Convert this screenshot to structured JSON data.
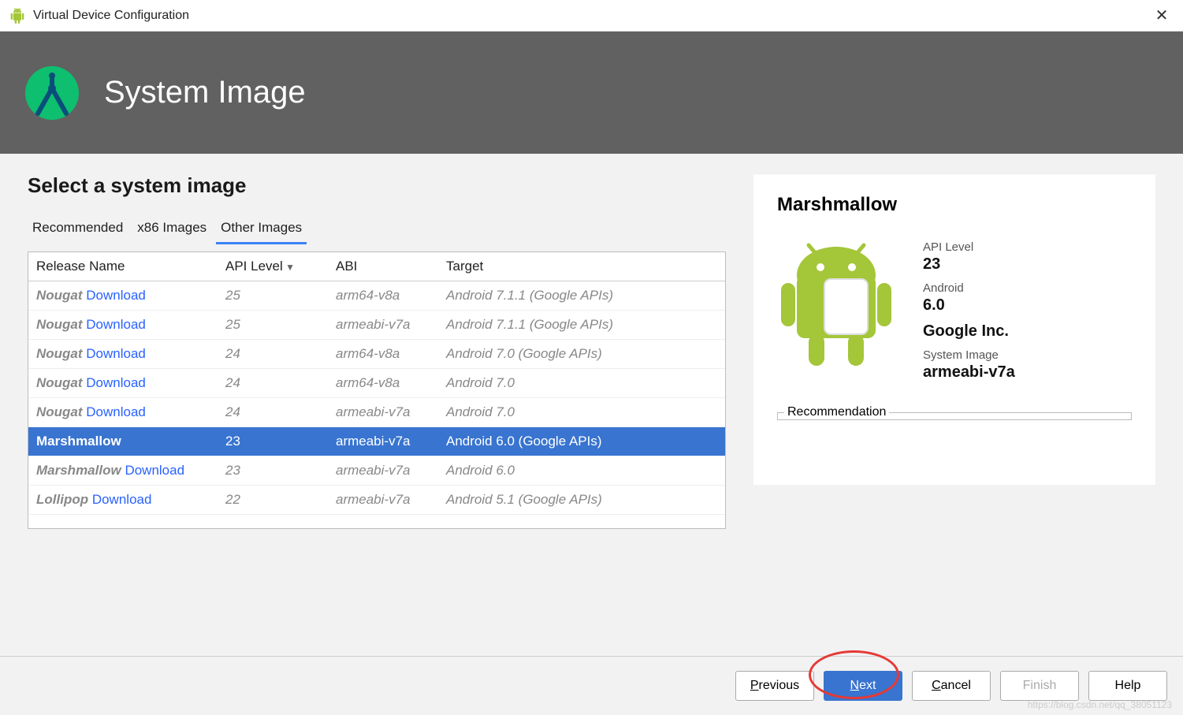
{
  "window": {
    "title": "Virtual Device Configuration"
  },
  "banner": {
    "title": "System Image"
  },
  "page": {
    "heading": "Select a system image"
  },
  "tabs": [
    {
      "label": "Recommended",
      "active": false
    },
    {
      "label": "x86 Images",
      "active": false
    },
    {
      "label": "Other Images",
      "active": true
    }
  ],
  "table": {
    "columns": [
      "Release Name",
      "API Level",
      "ABI",
      "Target"
    ],
    "sortedColumnIndex": 1,
    "rows": [
      {
        "release": "Nougat",
        "download": "Download",
        "api": "25",
        "abi": "arm64-v8a",
        "target": "Android 7.1.1 (Google APIs)",
        "selected": false,
        "hasDownload": true
      },
      {
        "release": "Nougat",
        "download": "Download",
        "api": "25",
        "abi": "armeabi-v7a",
        "target": "Android 7.1.1 (Google APIs)",
        "selected": false,
        "hasDownload": true
      },
      {
        "release": "Nougat",
        "download": "Download",
        "api": "24",
        "abi": "arm64-v8a",
        "target": "Android 7.0 (Google APIs)",
        "selected": false,
        "hasDownload": true
      },
      {
        "release": "Nougat",
        "download": "Download",
        "api": "24",
        "abi": "arm64-v8a",
        "target": "Android 7.0",
        "selected": false,
        "hasDownload": true
      },
      {
        "release": "Nougat",
        "download": "Download",
        "api": "24",
        "abi": "armeabi-v7a",
        "target": "Android 7.0",
        "selected": false,
        "hasDownload": true
      },
      {
        "release": "Marshmallow",
        "download": "",
        "api": "23",
        "abi": "armeabi-v7a",
        "target": "Android 6.0 (Google APIs)",
        "selected": true,
        "hasDownload": false
      },
      {
        "release": "Marshmallow",
        "download": "Download",
        "api": "23",
        "abi": "armeabi-v7a",
        "target": "Android 6.0",
        "selected": false,
        "hasDownload": true
      },
      {
        "release": "Lollipop",
        "download": "Download",
        "api": "22",
        "abi": "armeabi-v7a",
        "target": "Android 5.1 (Google APIs)",
        "selected": false,
        "hasDownload": true
      }
    ]
  },
  "detail": {
    "title": "Marshmallow",
    "apiLevelLabel": "API Level",
    "apiLevel": "23",
    "androidLabel": "Android",
    "androidVersion": "6.0",
    "vendor": "Google Inc.",
    "systemImageLabel": "System Image",
    "systemImage": "armeabi-v7a",
    "recommendationLabel": "Recommendation"
  },
  "footer": {
    "previous": "Previous",
    "next": "Next",
    "cancel": "Cancel",
    "finish": "Finish",
    "help": "Help"
  },
  "watermark": "https://blog.csdn.net/qq_38051123"
}
